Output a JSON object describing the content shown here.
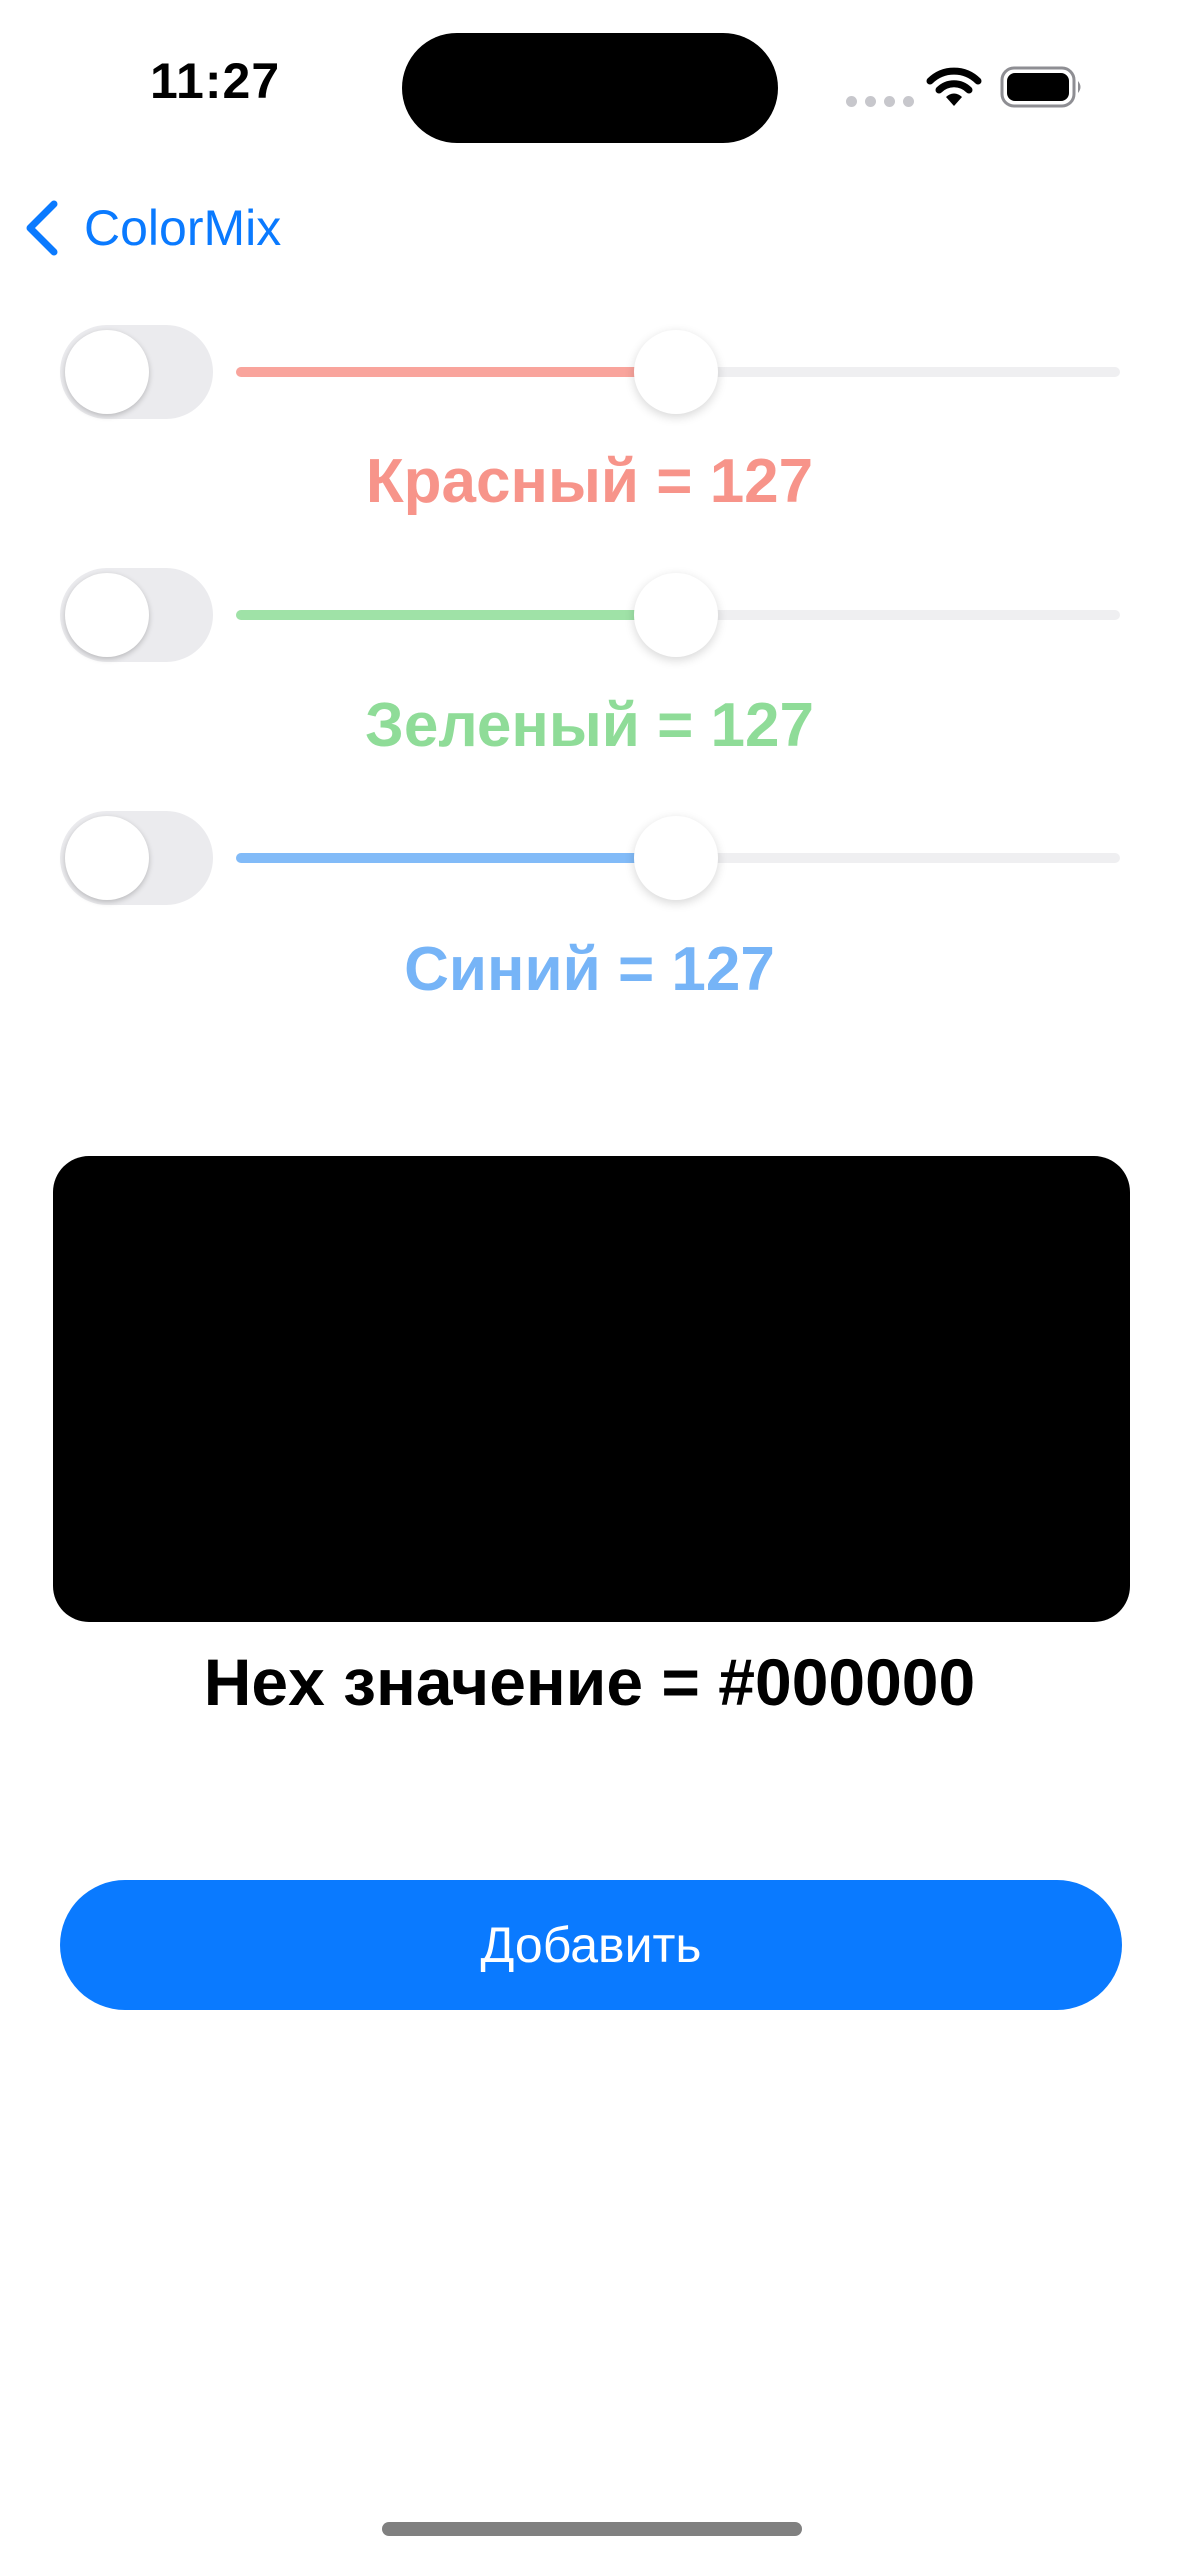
{
  "status_bar": {
    "time": "11:27"
  },
  "nav": {
    "back_label": "ColorMix"
  },
  "channels": [
    {
      "id": "red",
      "label": "Красный = 127",
      "value": 127,
      "max": 255,
      "toggle_on": false,
      "color": "#f7948a",
      "fill_color": "#f9a49c"
    },
    {
      "id": "green",
      "label": "Зеленый = 127",
      "value": 127,
      "max": 255,
      "toggle_on": false,
      "color": "#8fdc98",
      "fill_color": "#9fe2a7"
    },
    {
      "id": "blue",
      "label": "Синий = 127",
      "value": 127,
      "max": 255,
      "toggle_on": false,
      "color": "#76b4f7",
      "fill_color": "#82bbf8"
    }
  ],
  "preview": {
    "color": "#000000",
    "hex_label": "Hex значение = #000000"
  },
  "actions": {
    "add_label": "Добавить"
  },
  "theme": {
    "accent": "#0a7aff",
    "background": "#ffffff"
  },
  "icons": {
    "back": "chevron-left-icon",
    "wifi": "wifi-icon",
    "battery": "battery-icon",
    "signal": "cellular-signal-icon"
  }
}
